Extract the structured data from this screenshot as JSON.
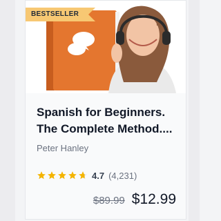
{
  "course": {
    "badge": "BESTSELLER",
    "title": "Spanish for Beginners. The Complete Method....",
    "author": "Peter Hanley",
    "rating": {
      "value": "4.7",
      "count": "(4,231)",
      "stars": 4.7
    },
    "price": {
      "original": "$89.99",
      "current": "$12.99"
    }
  },
  "colors": {
    "badge_bg": "#f7c873",
    "star": "#f4b400",
    "book_cover": "#e4762f"
  },
  "icons": [
    "speech-bubbles-icon",
    "star-icon"
  ]
}
